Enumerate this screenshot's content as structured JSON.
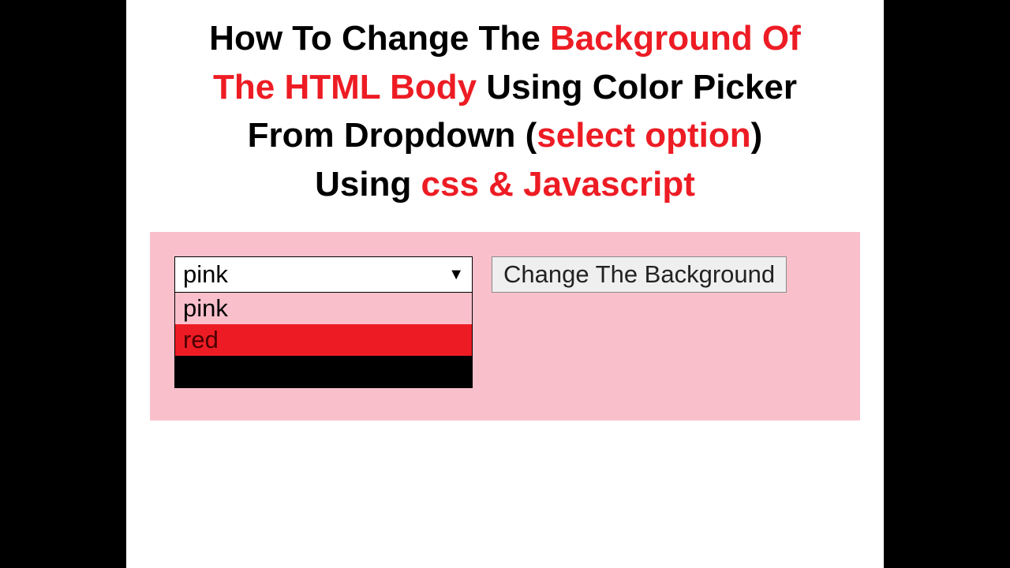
{
  "title": {
    "line1_a": "How To Change The ",
    "line1_b": "Background Of",
    "line2_a": "The HTML Body",
    "line2_b": "  Using Color Picker",
    "line3_a": "From Dropdown (",
    "line3_b": "select option",
    "line3_c": ")",
    "line4_a": "Using ",
    "line4_b": "css & Javascript"
  },
  "dropdown": {
    "selected": "pink",
    "options": {
      "pink": "pink",
      "red": "red",
      "black": ""
    }
  },
  "button": {
    "label": "Change The Background"
  },
  "colors": {
    "panel_bg": "#f9c0cb",
    "accent_red": "#ed1c24",
    "black": "#000000"
  }
}
